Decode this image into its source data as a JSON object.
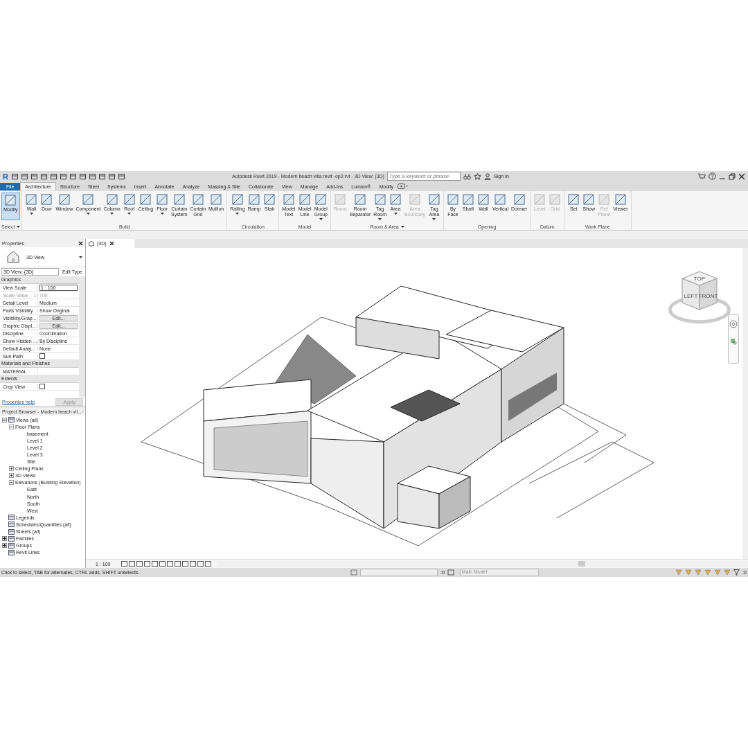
{
  "title_bar": {
    "logo": "R",
    "title": "Autodesk Revit 2019 - Modern beach villa revit -op2.rvt - 3D View: {3D}",
    "search": {
      "placeholder": "Type a keyword or phrase"
    },
    "sign_in": "Sign In"
  },
  "tabs": [
    {
      "label": "File",
      "selected": false,
      "kind": "file"
    },
    {
      "label": "Architecture",
      "selected": true,
      "kind": "tab"
    },
    {
      "label": "Structure",
      "selected": false,
      "kind": "tab"
    },
    {
      "label": "Steel",
      "selected": false,
      "kind": "tab"
    },
    {
      "label": "Systems",
      "selected": false,
      "kind": "tab"
    },
    {
      "label": "Insert",
      "selected": false,
      "kind": "tab"
    },
    {
      "label": "Annotate",
      "selected": false,
      "kind": "tab"
    },
    {
      "label": "Analyze",
      "selected": false,
      "kind": "tab"
    },
    {
      "label": "Massing & Site",
      "selected": false,
      "kind": "tab"
    },
    {
      "label": "Collaborate",
      "selected": false,
      "kind": "tab"
    },
    {
      "label": "View",
      "selected": false,
      "kind": "tab"
    },
    {
      "label": "Manage",
      "selected": false,
      "kind": "tab"
    },
    {
      "label": "Add-Ins",
      "selected": false,
      "kind": "tab"
    },
    {
      "label": "Lumion®",
      "selected": false,
      "kind": "tab"
    },
    {
      "label": "Modify",
      "selected": false,
      "kind": "tab"
    }
  ],
  "ribbon": [
    {
      "label": "Select",
      "dropdown": true,
      "tools": [
        {
          "label": "Modify",
          "selected": true,
          "disabled": false,
          "dropdown": false
        }
      ]
    },
    {
      "label": "Build",
      "dropdown": false,
      "tools": [
        {
          "label": "Wall",
          "selected": false,
          "disabled": false,
          "dropdown": true
        },
        {
          "label": "Door",
          "selected": false,
          "disabled": false,
          "dropdown": false
        },
        {
          "label": "Window",
          "selected": false,
          "disabled": false,
          "dropdown": false
        },
        {
          "label": "Component",
          "selected": false,
          "disabled": false,
          "dropdown": true
        },
        {
          "label": "Column",
          "selected": false,
          "disabled": false,
          "dropdown": true
        },
        {
          "label": "Roof",
          "selected": false,
          "disabled": false,
          "dropdown": true
        },
        {
          "label": "Ceiling",
          "selected": false,
          "disabled": false,
          "dropdown": false
        },
        {
          "label": "Floor",
          "selected": false,
          "disabled": false,
          "dropdown": true
        },
        {
          "label": "Curtain System",
          "selected": false,
          "disabled": false,
          "dropdown": false
        },
        {
          "label": "Curtain Grid",
          "selected": false,
          "disabled": false,
          "dropdown": false
        },
        {
          "label": "Mullion",
          "selected": false,
          "disabled": false,
          "dropdown": false
        }
      ]
    },
    {
      "label": "Circulation",
      "dropdown": false,
      "tools": [
        {
          "label": "Railing",
          "selected": false,
          "disabled": false,
          "dropdown": true
        },
        {
          "label": "Ramp",
          "selected": false,
          "disabled": false,
          "dropdown": false
        },
        {
          "label": "Stair",
          "selected": false,
          "disabled": false,
          "dropdown": false
        }
      ]
    },
    {
      "label": "Model",
      "dropdown": false,
      "tools": [
        {
          "label": "Model Text",
          "selected": false,
          "disabled": false,
          "dropdown": false
        },
        {
          "label": "Model Line",
          "selected": false,
          "disabled": false,
          "dropdown": false
        },
        {
          "label": "Model Group",
          "selected": false,
          "disabled": false,
          "dropdown": true
        }
      ]
    },
    {
      "label": "Room & Area",
      "dropdown": true,
      "tools": [
        {
          "label": "Room",
          "selected": false,
          "disabled": true,
          "dropdown": false
        },
        {
          "label": "Room Separator",
          "selected": false,
          "disabled": false,
          "dropdown": false
        },
        {
          "label": "Tag Room",
          "selected": false,
          "disabled": false,
          "dropdown": true
        },
        {
          "label": "Area",
          "selected": false,
          "disabled": false,
          "dropdown": true
        },
        {
          "label": "Area Boundary",
          "selected": false,
          "disabled": true,
          "dropdown": false
        },
        {
          "label": "Tag Area",
          "selected": false,
          "disabled": false,
          "dropdown": true
        }
      ]
    },
    {
      "label": "Opening",
      "dropdown": false,
      "tools": [
        {
          "label": "By Face",
          "selected": false,
          "disabled": false,
          "dropdown": false
        },
        {
          "label": "Shaft",
          "selected": false,
          "disabled": false,
          "dropdown": false
        },
        {
          "label": "Wall",
          "selected": false,
          "disabled": false,
          "dropdown": false
        },
        {
          "label": "Vertical",
          "selected": false,
          "disabled": false,
          "dropdown": false
        },
        {
          "label": "Dormer",
          "selected": false,
          "disabled": false,
          "dropdown": false
        }
      ]
    },
    {
      "label": "Datum",
      "dropdown": false,
      "tools": [
        {
          "label": "Level",
          "selected": false,
          "disabled": true,
          "dropdown": false
        },
        {
          "label": "Grid",
          "selected": false,
          "disabled": true,
          "dropdown": false
        }
      ]
    },
    {
      "label": "Work Plane",
      "dropdown": false,
      "tools": [
        {
          "label": "Set",
          "selected": false,
          "disabled": false,
          "dropdown": false
        },
        {
          "label": "Show",
          "selected": false,
          "disabled": false,
          "dropdown": false
        },
        {
          "label": "Ref Plane",
          "selected": false,
          "disabled": true,
          "dropdown": false
        },
        {
          "label": "Viewer",
          "selected": false,
          "disabled": false,
          "dropdown": false
        }
      ]
    }
  ],
  "properties": {
    "title": "Properties",
    "type_name": "3D View",
    "view_selector": "3D View: {3D}",
    "edit_type": "Edit Type",
    "groups": [
      {
        "label": "Graphics",
        "rows": [
          {
            "label": "View Scale",
            "value": "1 : 100",
            "kind": "field",
            "disabled": false
          },
          {
            "label": "Scale Value    1:",
            "value": "100",
            "kind": "text",
            "disabled": true
          },
          {
            "label": "Detail Level",
            "value": "Medium",
            "kind": "text",
            "disabled": false
          },
          {
            "label": "Parts Visibility",
            "value": "Show Original",
            "kind": "text",
            "disabled": false
          },
          {
            "label": "Visibility/Grap...",
            "value": "Edit...",
            "kind": "button",
            "disabled": false
          },
          {
            "label": "Graphic Displ...",
            "value": "Edit...",
            "kind": "button",
            "disabled": false
          },
          {
            "label": "Discipline",
            "value": "Coordination",
            "kind": "text",
            "disabled": false
          },
          {
            "label": "Show Hidden ...",
            "value": "By Discipline",
            "kind": "text",
            "disabled": false
          },
          {
            "label": "Default Analy...",
            "value": "None",
            "kind": "text",
            "disabled": false
          },
          {
            "label": "Sun Path",
            "checked": false,
            "kind": "checkbox",
            "disabled": false
          }
        ]
      },
      {
        "label": "Materials and Finishes",
        "rows": [
          {
            "label": "MATERIAL",
            "value": "",
            "kind": "text",
            "disabled": false
          }
        ]
      },
      {
        "label": "Extents",
        "rows": [
          {
            "label": "Crop View",
            "checked": false,
            "kind": "checkbox",
            "disabled": false
          }
        ]
      }
    ],
    "help_link": "Properties help",
    "apply": "Apply"
  },
  "project_browser": {
    "title": "Project Browser - Modern beach vil...",
    "tree": [
      {
        "label": "Views (all)",
        "expanded": true,
        "children": [
          {
            "label": "Floor Plans",
            "expanded": true,
            "children": [
              {
                "label": "basement"
              },
              {
                "label": "Level 1"
              },
              {
                "label": "Level 2"
              },
              {
                "label": "Level 3"
              },
              {
                "label": "Site"
              }
            ]
          },
          {
            "label": "Ceiling Plans",
            "expanded": false
          },
          {
            "label": "3D Views",
            "expanded": false
          },
          {
            "label": "Elevations (Building Elevation)",
            "expanded": true,
            "children": [
              {
                "label": "East"
              },
              {
                "label": "North"
              },
              {
                "label": "South"
              },
              {
                "label": "West"
              }
            ]
          }
        ]
      },
      {
        "label": "Legends"
      },
      {
        "label": "Schedules/Quantities (all)"
      },
      {
        "label": "Sheets (all)"
      },
      {
        "label": "Families",
        "expanded": false
      },
      {
        "label": "Groups",
        "expanded": false
      },
      {
        "label": "Revit Links"
      }
    ]
  },
  "view": {
    "tab": "{3D}",
    "cube": {
      "top": "TOP",
      "left": "LEFT",
      "front": "FRONT"
    },
    "scale": "1 : 100"
  },
  "status_bar": {
    "message": "Click to select, TAB for alternates, CTRL adds, SHIFT unselects.",
    "count": ":0",
    "model": "Main Model",
    "filter_count": ":0"
  }
}
